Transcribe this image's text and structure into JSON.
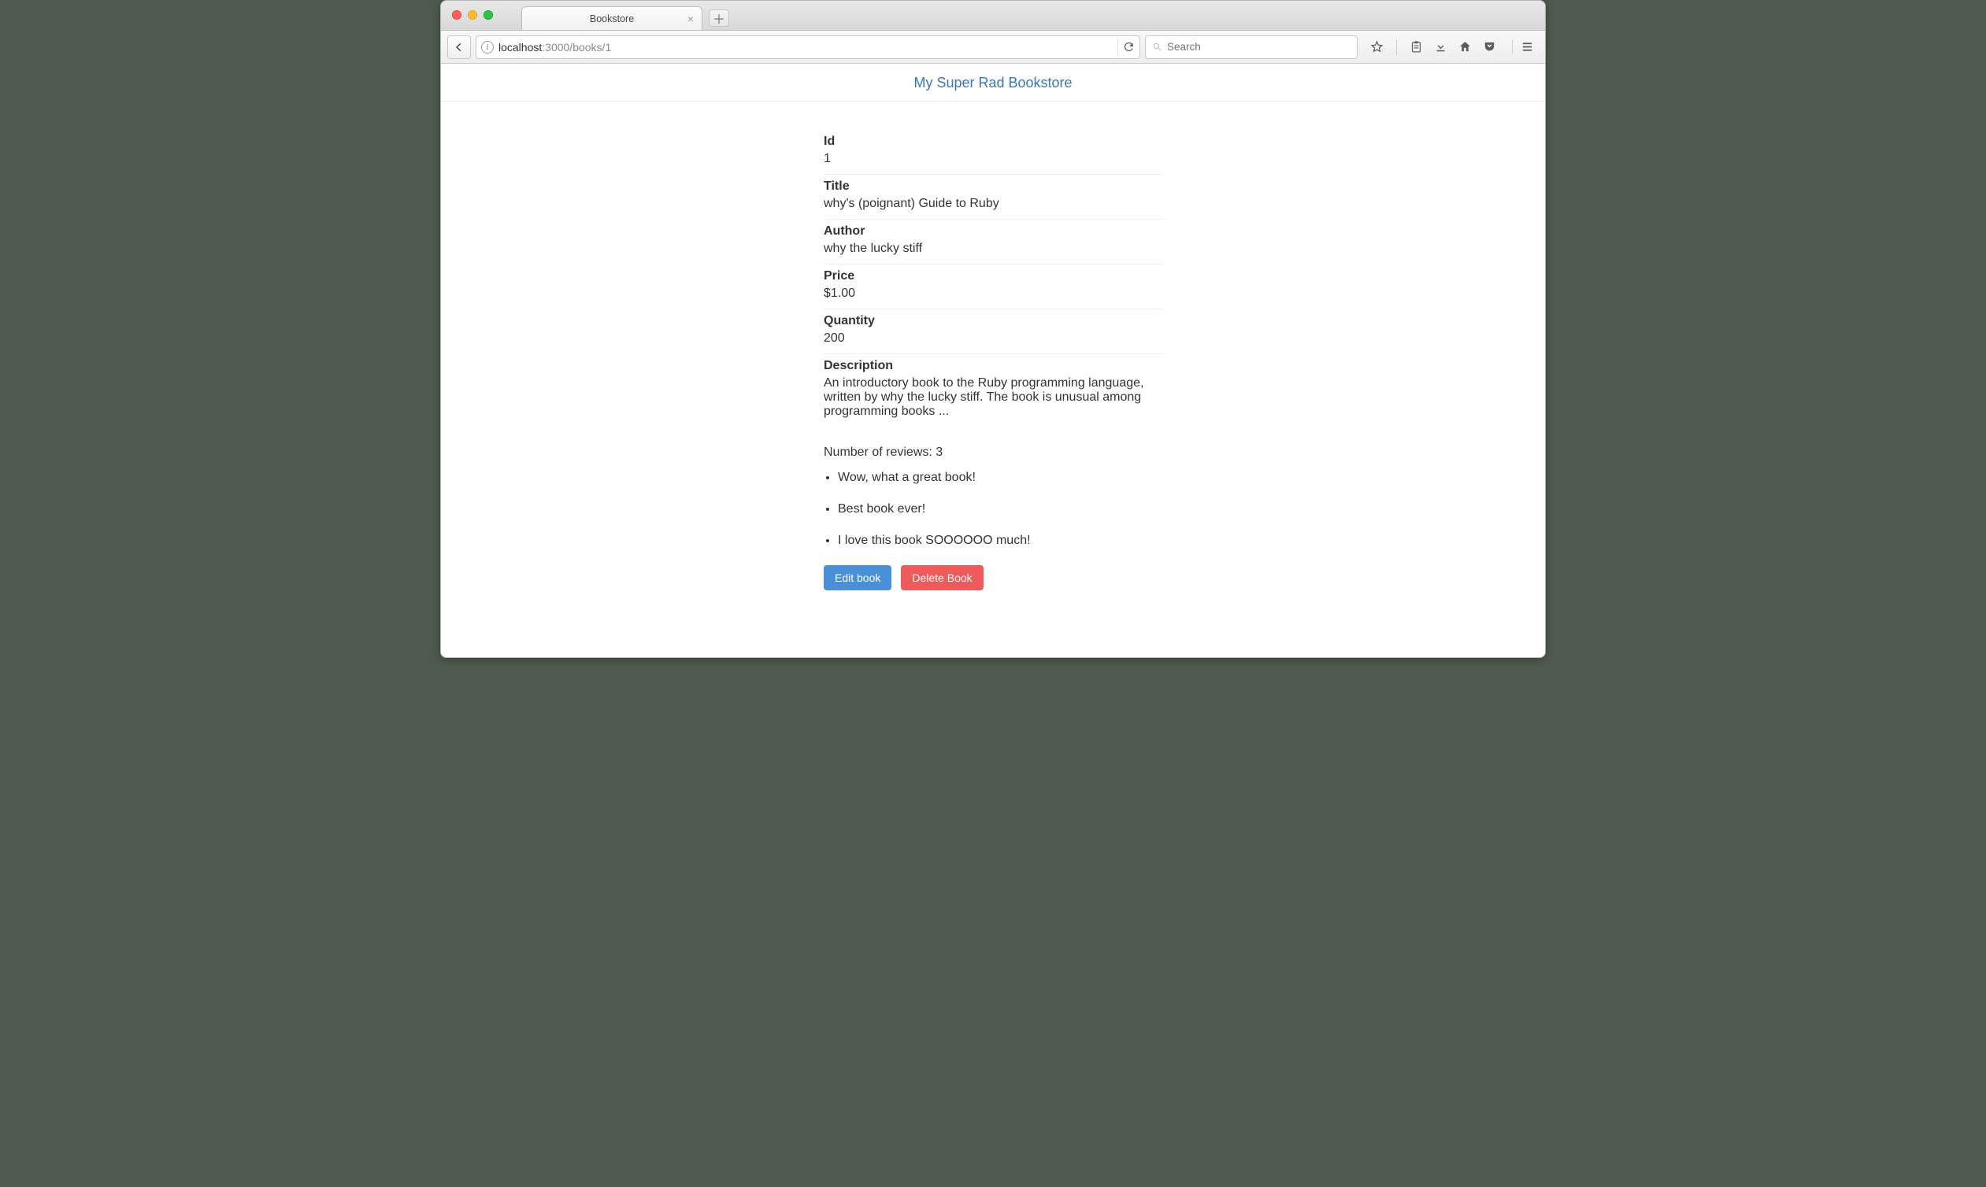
{
  "window": {
    "tab_title": "Bookstore",
    "url_host": "localhost",
    "url_rest": ":3000/books/1",
    "search_placeholder": "Search"
  },
  "header": {
    "brand": "My Super Rad Bookstore"
  },
  "book": {
    "labels": {
      "id": "Id",
      "title": "Title",
      "author": "Author",
      "price": "Price",
      "quantity": "Quantity",
      "description": "Description"
    },
    "id": "1",
    "title": "why's (poignant) Guide to Ruby",
    "author": "why the lucky stiff",
    "price": "$1.00",
    "quantity": "200",
    "description": "An introductory book to the Ruby programming language, written by why the lucky stiff. The book is unusual among programming books ..."
  },
  "reviews": {
    "count_label": "Number of reviews: 3",
    "items": [
      "Wow, what a great book!",
      "Best book ever!",
      "I love this book SOOOOOO much!"
    ]
  },
  "actions": {
    "edit": "Edit book",
    "delete": "Delete Book"
  }
}
